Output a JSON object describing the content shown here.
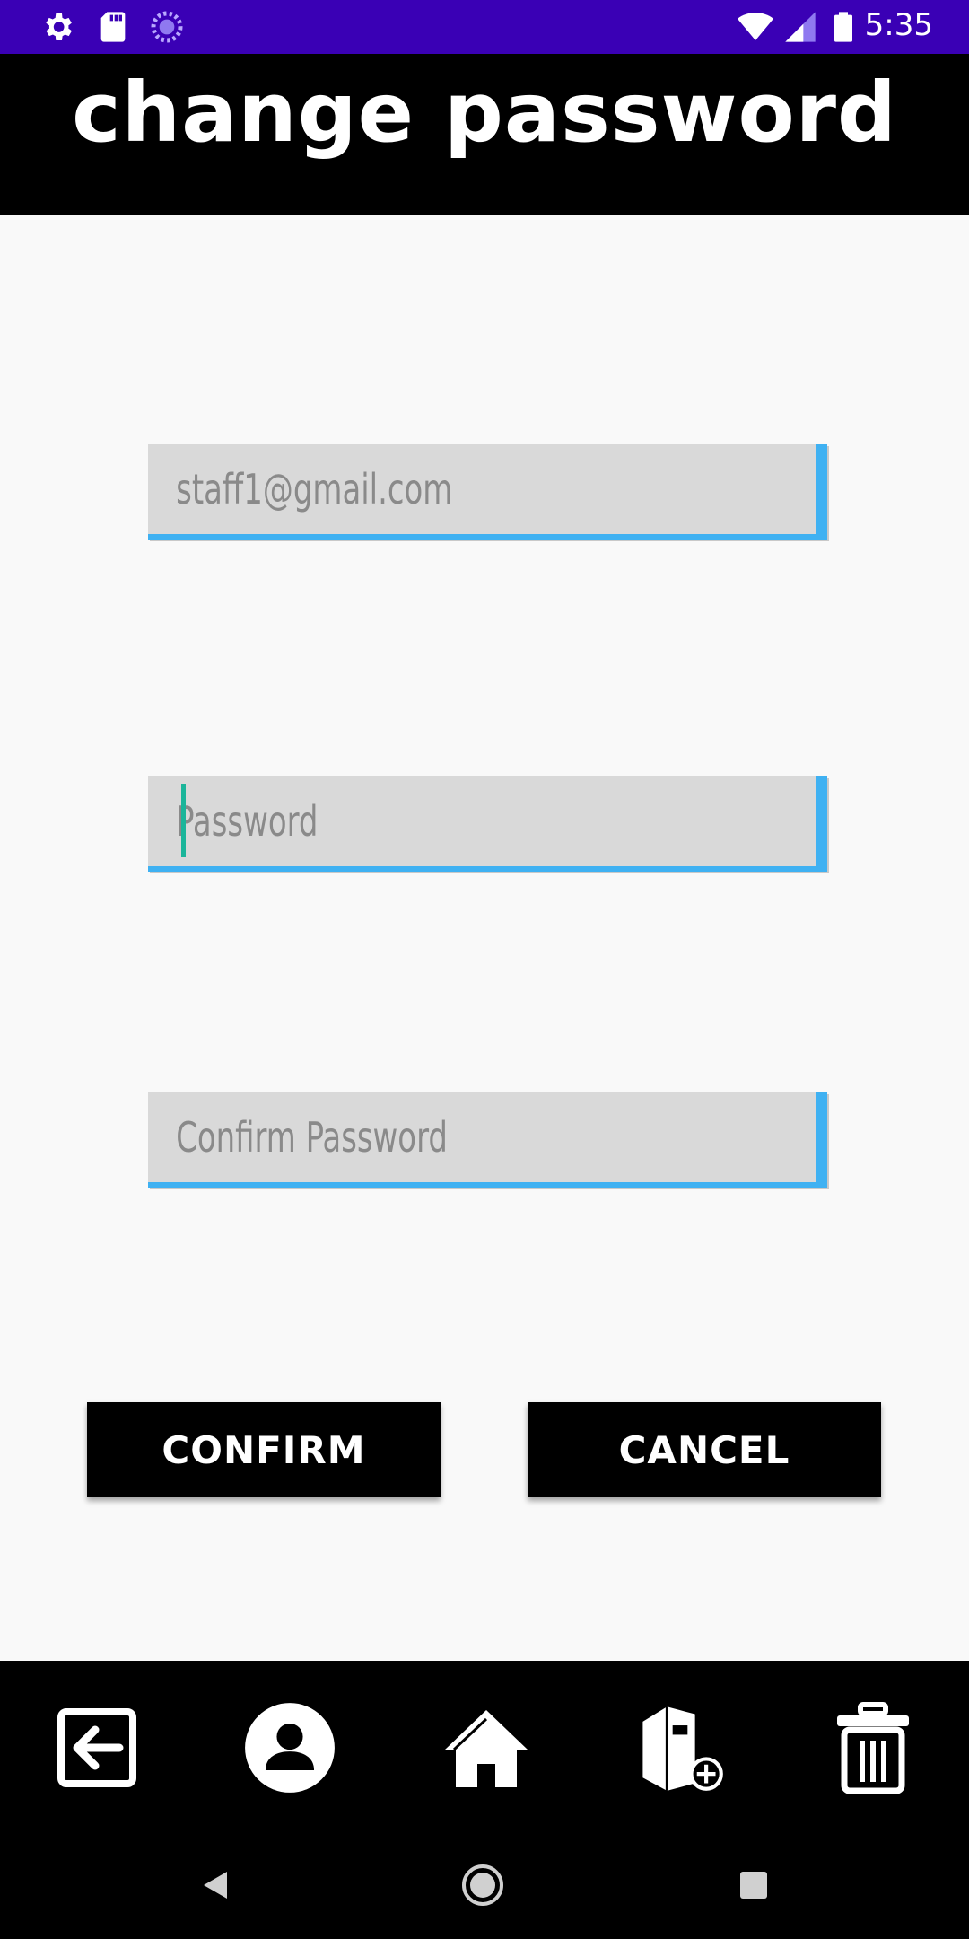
{
  "status_bar": {
    "time": "5:35",
    "icons": [
      "settings-icon",
      "sd-card-icon",
      "sync-icon",
      "wifi-icon",
      "cell-signal-icon",
      "battery-icon"
    ]
  },
  "header": {
    "title": "change password"
  },
  "form": {
    "email": {
      "value": "staff1@gmail.com",
      "placeholder": ""
    },
    "password": {
      "value": "",
      "placeholder": "Password"
    },
    "confirm_password": {
      "value": "",
      "placeholder": "Confirm Password"
    }
  },
  "buttons": {
    "confirm_label": "CONFIRM",
    "cancel_label": "CANCEL"
  },
  "bottom_nav": {
    "items": [
      "logout-icon",
      "profile-icon",
      "home-icon",
      "add-book-icon",
      "delete-icon"
    ]
  },
  "system_nav": [
    "back-icon",
    "home-circle-icon",
    "recents-icon"
  ],
  "colors": {
    "status_bar": "#3a00b5",
    "header": "#000000",
    "field_bg": "#d9d9d9",
    "field_accent": "#3fb1f2",
    "caret": "#1bb59a",
    "button": "#000000"
  }
}
